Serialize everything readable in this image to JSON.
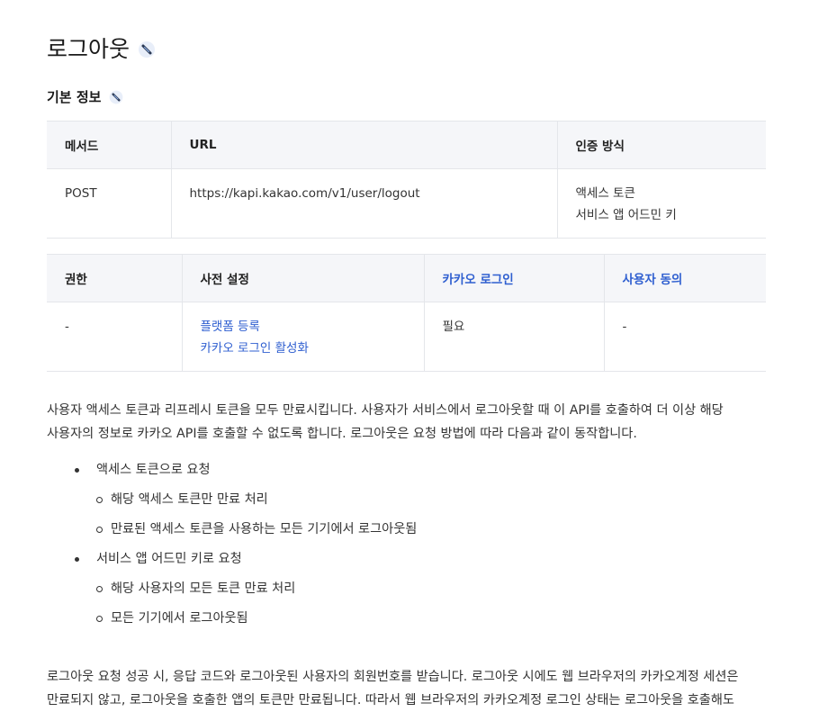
{
  "page": {
    "title": "로그아웃",
    "section_title": "기본 정보"
  },
  "icons": {
    "anchor": "link-icon"
  },
  "basic_table": {
    "headers": [
      "메서드",
      "URL",
      "인증 방식"
    ],
    "method": "POST",
    "url": "https://kapi.kakao.com/v1/user/logout",
    "auth": [
      "액세스 토큰",
      "서비스 앱 어드민 키"
    ]
  },
  "perm_table": {
    "headers": [
      "권한",
      "사전 설정",
      "카카오 로그인",
      "사용자 동의"
    ],
    "permission": "-",
    "prereq_links": [
      "플랫폼 등록",
      "카카오 로그인 활성화"
    ],
    "kakao_login": "필요",
    "user_consent": "-"
  },
  "body": {
    "intro_line1": "사용자 액세스 토큰과 리프레시 토큰을 모두 만료시킵니다. 사용자가 서비스에서 로그아웃할 때 이 API를 호출하여 더 이상 해당",
    "intro_line2": "사용자의 정보로 카카오 API를 호출할 수 없도록 합니다. 로그아웃은 요청 방법에 따라 다음과 같이 동작합니다.",
    "bullets": [
      {
        "label": "액세스 토큰으로 요청",
        "sub": [
          "해당 액세스 토큰만 만료 처리",
          "만료된 액세스 토큰을 사용하는 모든 기기에서 로그아웃됨"
        ]
      },
      {
        "label": "서비스 앱 어드민 키로 요청",
        "sub": [
          "해당 사용자의 모든 토큰 만료 처리",
          "모든 기기에서 로그아웃됨"
        ]
      }
    ],
    "outro_line1": "로그아웃 요청 성공 시, 응답 코드와 로그아웃된 사용자의 회원번호를 받습니다. 로그아웃 시에도 웹 브라우저의 카카오계정 세션은",
    "outro_line2": "만료되지 않고, 로그아웃을 호출한 앱의 토큰만 만료됩니다. 따라서 웹 브라우저의 카카오계정 로그인 상태는 로그아웃을 호출해도"
  },
  "colors": {
    "link": "#2f5fd0",
    "header_bg": "#f5f6f9",
    "border": "#e4e6ea"
  }
}
